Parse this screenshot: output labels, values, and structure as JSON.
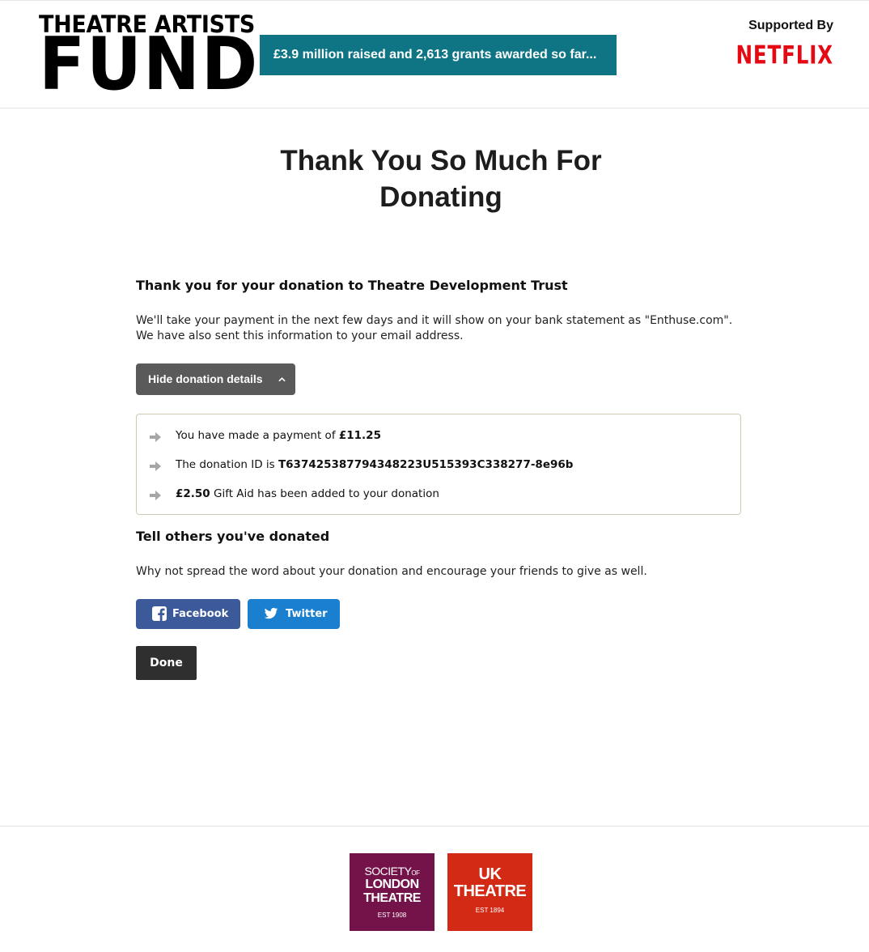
{
  "header": {
    "logo_line1": "THEATRE ARTISTS",
    "logo_line2": "FUND",
    "banner_text": "£3.9 million raised and 2,613 grants awarded so far...",
    "supported_by_label": "Supported By",
    "sponsor_name": "NETFLIX"
  },
  "page": {
    "title_line1": "Thank You So Much For",
    "title_line2": "Donating"
  },
  "thanks": {
    "heading": "Thank you for your donation to Theatre Development Trust",
    "line1": "We'll take your payment in the next few days and it will show on your bank statement as \"Enthuse.com\".",
    "line2": "We have also sent this information to your email address."
  },
  "details_toggle": {
    "label": "Hide donation details"
  },
  "details": {
    "payment_prefix": "You have made a payment of ",
    "payment_amount": "£11.25",
    "donation_id_prefix": "The donation ID is ",
    "donation_id": "T637425387794348223U515393C338277-8e96b",
    "gift_aid_amount": "£2.50",
    "gift_aid_suffix": " Gift Aid has been added to your donation"
  },
  "share": {
    "heading": "Tell others you've donated",
    "text": "Why not spread the word about your donation and encourage your friends to give as well.",
    "facebook_label": "Facebook",
    "twitter_label": "Twitter"
  },
  "done_label": "Done",
  "footer": {
    "solt_line1": "SOCIETY",
    "solt_of": "OF",
    "solt_line2": "LONDON",
    "solt_line3": "THEATRE",
    "solt_est": "EST 1908",
    "ukt_line1": "UK",
    "ukt_line2": "THEATRE",
    "ukt_est": "EST 1894"
  },
  "colors": {
    "banner": "#0f7585",
    "netflix": "#e50914",
    "facebook": "#3c5a9a",
    "twitter": "#1a7fcf",
    "done": "#2f2f2f",
    "toggle": "#5a5a5a",
    "solt": "#74134a",
    "ukt": "#d22a14"
  },
  "icons": {
    "details_toggle": "chevron-up-icon",
    "detail_bullet": "arrow-right-icon",
    "facebook": "facebook-icon",
    "twitter": "twitter-icon"
  }
}
